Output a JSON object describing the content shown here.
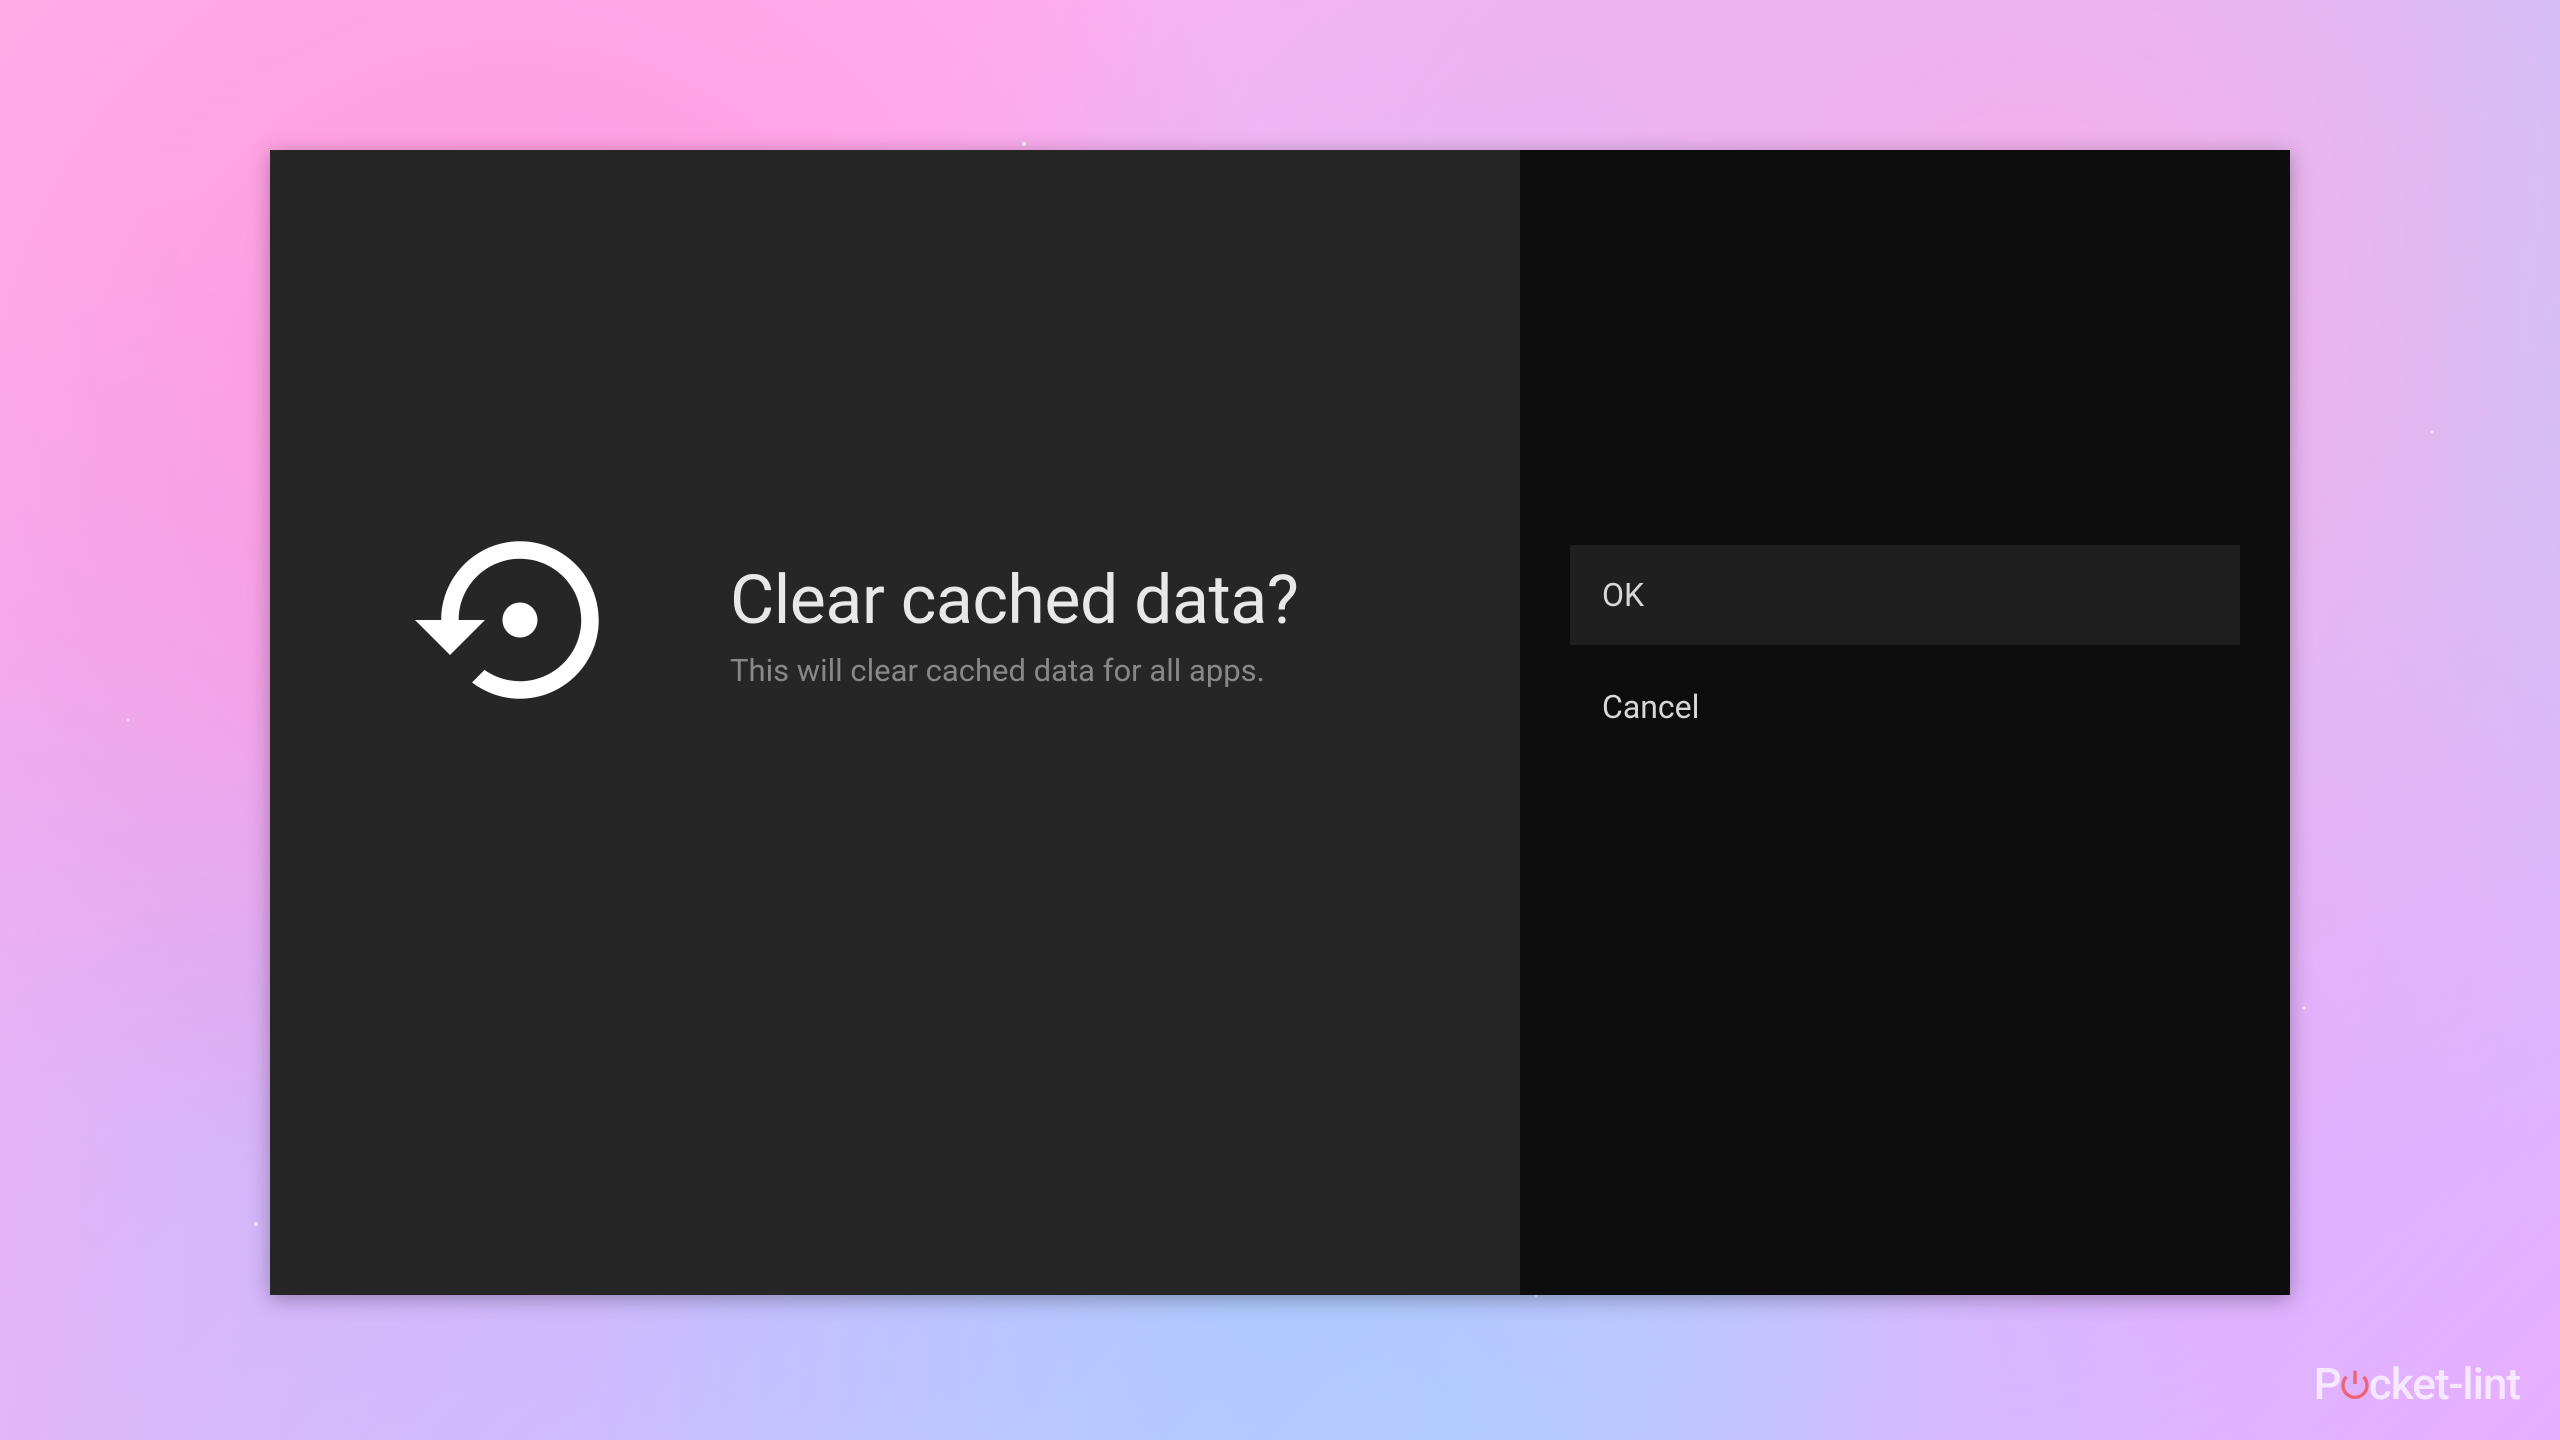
{
  "dialog": {
    "icon_name": "restore-icon",
    "title": "Clear cached data?",
    "description": "This will clear cached data for all apps."
  },
  "actions": {
    "ok_label": "OK",
    "cancel_label": "Cancel"
  },
  "watermark": {
    "brand_prefix": "P",
    "brand_suffix": "cket-lint"
  },
  "colors": {
    "left_panel_bg": "#262626",
    "right_panel_bg": "#0d0d0d",
    "title_text": "#e8e8e8",
    "description_text": "#888888",
    "button_selected_bg": "#1f1f1f",
    "button_text": "#d8d8d8"
  }
}
